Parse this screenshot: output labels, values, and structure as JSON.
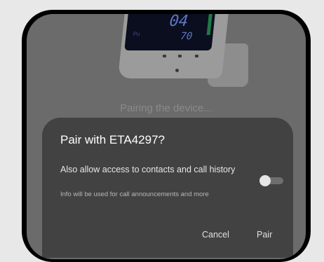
{
  "device_display": {
    "reading_top": "04",
    "reading_bottom": "70",
    "small_label": "Pu"
  },
  "status": {
    "text": "Pairing the device..."
  },
  "dialog": {
    "title": "Pair with ETA4297?",
    "permission_title": "Also allow access to contacts and call history",
    "permission_description": "Info will be used for call announcements and more",
    "toggle_state": "off",
    "cancel_label": "Cancel",
    "pair_label": "Pair"
  },
  "colors": {
    "dialog_bg": "#424242",
    "scrim": "#6b6b6b",
    "device_screen_accent": "#1e7a44"
  }
}
